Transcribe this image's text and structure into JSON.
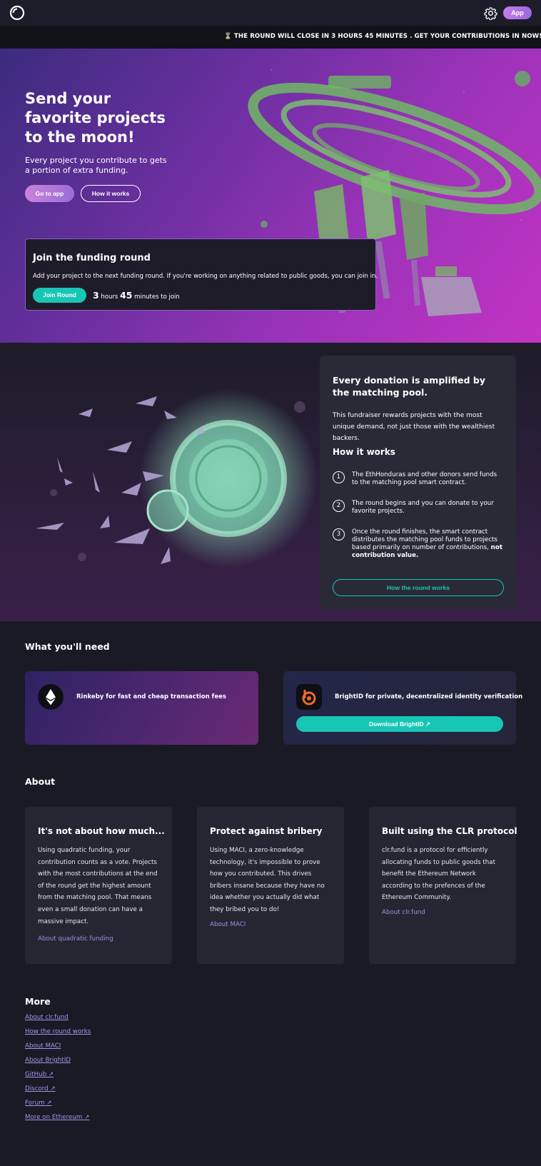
{
  "header": {
    "app_label": "App"
  },
  "banner": {
    "text": "⌛ THE ROUND WILL CLOSE IN 3 HOURS 45 MINUTES . GET YOUR CONTRIBUTIONS IN NOW!"
  },
  "hero": {
    "title": "Send your favorite projects to the moon!",
    "subtitle": "Every project you contribute to gets a portion of extra funding.",
    "go_to_app": "Go to app",
    "how_it_works": "How it works"
  },
  "join": {
    "title": "Join the funding round",
    "text": "Add your project to the next funding round. If you're working on anything related to public goods, you can join in.",
    "button": "Join Round",
    "hours_value": "3",
    "hours_unit": "hours",
    "minutes_value": "45",
    "minutes_unit": "minutes to join"
  },
  "amplify": {
    "title": "Every donation is amplified by the matching pool.",
    "text": "This fundraiser rewards projects with the most unique demand, not just those with the wealthiest backers.",
    "how_title": "How it works",
    "steps": [
      {
        "num": "1",
        "text": "The EthHonduras and other donors send funds to the matching pool smart contract."
      },
      {
        "num": "2",
        "text": "The round begins and you can donate to your favorite projects."
      },
      {
        "num": "3",
        "text": "Once the round finishes, the smart contract distributes the matching pool funds to projects based primarily on number of contributions,",
        "bold": "not contribution value."
      }
    ],
    "button": "How the round works"
  },
  "need": {
    "title": "What you'll need",
    "rinkeby": "Rinkeby for fast and cheap transaction fees",
    "brightid": "BrightID for private, decentralized identity verification",
    "download": "Download BrightID ↗"
  },
  "about": {
    "title": "About",
    "cards": [
      {
        "title": "It's not about how much...",
        "text": "Using quadratic funding, your contribution counts as a vote. Projects with the most contributions at the end of the round get the highest amount from the matching pool. That means even a small donation can have a massive impact.",
        "link": "About quadratic funding"
      },
      {
        "title": "Protect against bribery",
        "text": "Using MACI, a zero-knowledge technology, it's impossible to prove how you contributed. This drives bribers insane because they have no idea whether you actually did what they bribed you to do!",
        "link": "About MACI"
      },
      {
        "title": "Built using the CLR protocol",
        "text": "clr.fund is a protocol for efficiently allocating funds to public goods that benefit the Ethereum Network according to the prefences of the Ethereum Community.",
        "link": "About clr.fund"
      }
    ]
  },
  "more": {
    "title": "More",
    "links": [
      "About clr.fund",
      "How the round works",
      "About MACI",
      "About BrightID",
      "GitHub ↗",
      "Discord ↗",
      "Forum ↗",
      "More on Ethereum ↗"
    ]
  },
  "colors": {
    "accent": "#18c6b5",
    "link": "#9d8fe0",
    "background": "#1a1a25"
  }
}
